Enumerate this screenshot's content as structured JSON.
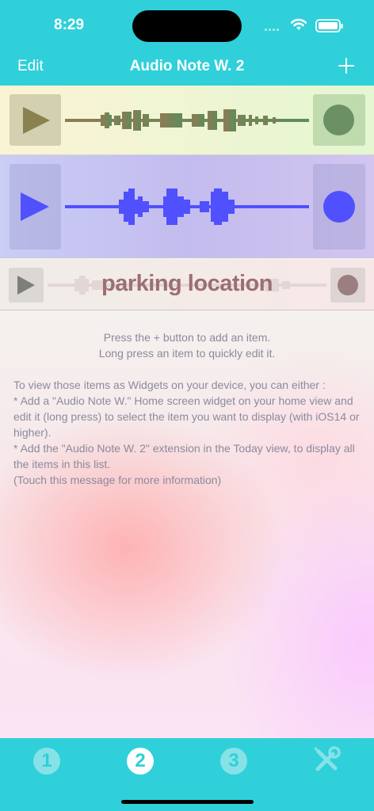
{
  "status": {
    "time": "8:29"
  },
  "nav": {
    "edit_label": "Edit",
    "title": "Audio Note W. 2",
    "add_icon": "plus-icon"
  },
  "items": [
    {
      "label": "",
      "accent": "#6b9063",
      "play_color": "#8a8151"
    },
    {
      "label": "",
      "accent": "#5050ff",
      "play_color": "#5050ff"
    },
    {
      "label": "parking location",
      "accent": "#9b6f73",
      "play_color": "#7e7f7a"
    }
  ],
  "info": {
    "hint1": "Press the + button to add an item.",
    "hint2": "Long press an item to quickly edit it.",
    "p1": "To view those items as Widgets on your device, you can either :",
    "p2": "* Add a \"Audio Note W.\" Home screen widget on your home view and edit it (long press) to select the item you want to display (with iOS14 or higher).",
    "p3": "* Add the \"Audio Note W. 2\" extension in the Today view, to display all the items in this list.",
    "p4": "(Touch this message for more information)"
  },
  "tabs": [
    {
      "label": "1",
      "active": false
    },
    {
      "label": "2",
      "active": true
    },
    {
      "label": "3",
      "active": false
    },
    {
      "icon": "tools-icon"
    }
  ],
  "colors": {
    "brand": "#2fd0d9"
  }
}
